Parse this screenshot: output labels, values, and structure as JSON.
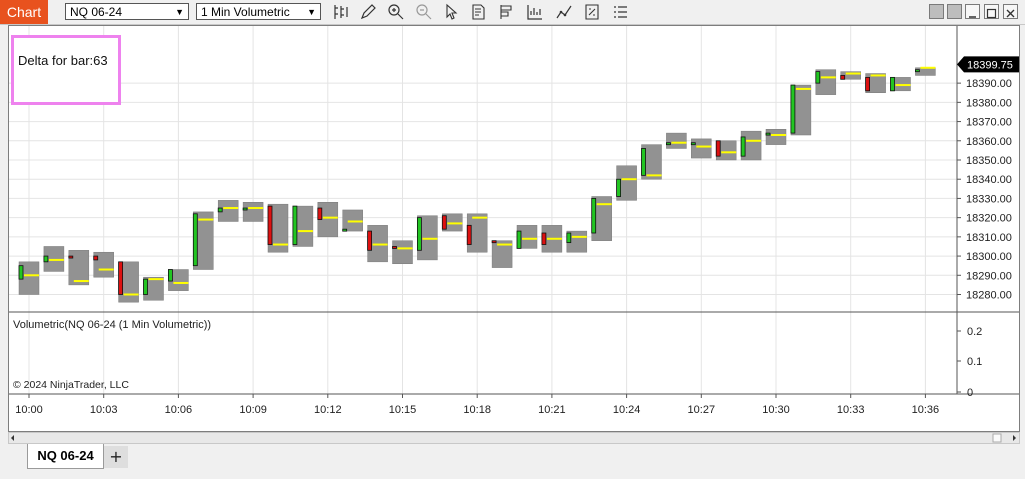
{
  "app": {
    "title": "Chart"
  },
  "toolbar": {
    "instrument": "NQ 06-24",
    "interval": "1 Min Volumetric",
    "icons": [
      "bars-type-icon",
      "draw-pencil-icon",
      "zoom-in-icon",
      "zoom-out-icon",
      "pointer-icon",
      "properties-icon",
      "templates-icon",
      "chart-trader-icon",
      "indicators-icon",
      "strategies-icon",
      "data-box-icon"
    ]
  },
  "window_buttons": [
    "tile-button",
    "grid-button",
    "minimize-button",
    "maximize-button",
    "close-button"
  ],
  "chart": {
    "delta_label": "Delta for bar:63",
    "last_price": "18399.75",
    "price_ticks": [
      "18390.00",
      "18380.00",
      "18370.00",
      "18360.00",
      "18350.00",
      "18340.00",
      "18330.00",
      "18320.00",
      "18310.00",
      "18300.00",
      "18290.00",
      "18280.00"
    ],
    "indicator_title": "Volumetric(NQ 06-24 (1 Min Volumetric))",
    "indicator_ticks": [
      "0.2",
      "0.1",
      "0"
    ],
    "copyright": "© 2024 NinjaTrader, LLC",
    "time_ticks": [
      "10:00",
      "10:03",
      "10:06",
      "10:09",
      "10:12",
      "10:15",
      "10:18",
      "10:21",
      "10:24",
      "10:27",
      "10:30",
      "10:33",
      "10:36"
    ]
  },
  "tabs": {
    "active": "NQ 06-24",
    "add": "+"
  },
  "chart_data": {
    "type": "candlestick",
    "bars": [
      {
        "t": "10:00",
        "o": 18288,
        "h": 18297,
        "l": 18280,
        "c": 18295,
        "poc": 18290
      },
      {
        "t": "10:01",
        "o": 18297,
        "h": 18305,
        "l": 18292,
        "c": 18300,
        "poc": 18298
      },
      {
        "t": "10:02",
        "o": 18300,
        "h": 18303,
        "l": 18285,
        "c": 18299,
        "poc": 18287
      },
      {
        "t": "10:03",
        "o": 18300,
        "h": 18302,
        "l": 18289,
        "c": 18298,
        "poc": 18293
      },
      {
        "t": "10:04",
        "o": 18297,
        "h": 18297,
        "l": 18276,
        "c": 18280,
        "poc": 18280
      },
      {
        "t": "10:05",
        "o": 18280,
        "h": 18289,
        "l": 18277,
        "c": 18288,
        "poc": 18288
      },
      {
        "t": "10:06",
        "o": 18287,
        "h": 18293,
        "l": 18282,
        "c": 18293,
        "poc": 18286
      },
      {
        "t": "10:07",
        "o": 18295,
        "h": 18323,
        "l": 18293,
        "c": 18322,
        "poc": 18319
      },
      {
        "t": "10:08",
        "o": 18323,
        "h": 18329,
        "l": 18318,
        "c": 18325,
        "poc": 18325
      },
      {
        "t": "10:09",
        "o": 18325,
        "h": 18328,
        "l": 18318,
        "c": 18325,
        "poc": 18325
      },
      {
        "t": "10:10",
        "o": 18326,
        "h": 18327,
        "l": 18302,
        "c": 18306,
        "poc": 18306
      },
      {
        "t": "10:11",
        "o": 18306,
        "h": 18326,
        "l": 18305,
        "c": 18326,
        "poc": 18313
      },
      {
        "t": "10:12",
        "o": 18325,
        "h": 18328,
        "l": 18310,
        "c": 18319,
        "poc": 18320
      },
      {
        "t": "10:13",
        "o": 18314,
        "h": 18324,
        "l": 18313,
        "c": 18314,
        "poc": 18318
      },
      {
        "t": "10:14",
        "o": 18313,
        "h": 18316,
        "l": 18297,
        "c": 18303,
        "poc": 18306
      },
      {
        "t": "10:15",
        "o": 18305,
        "h": 18308,
        "l": 18296,
        "c": 18304,
        "poc": 18304
      },
      {
        "t": "10:16",
        "o": 18303,
        "h": 18321,
        "l": 18298,
        "c": 18320,
        "poc": 18309
      },
      {
        "t": "10:17",
        "o": 18321,
        "h": 18322,
        "l": 18313,
        "c": 18314,
        "poc": 18317
      },
      {
        "t": "10:18",
        "o": 18316,
        "h": 18322,
        "l": 18302,
        "c": 18306,
        "poc": 18320
      },
      {
        "t": "10:19",
        "o": 18308,
        "h": 18308,
        "l": 18294,
        "c": 18307,
        "poc": 18306
      },
      {
        "t": "10:20",
        "o": 18304,
        "h": 18316,
        "l": 18304,
        "c": 18313,
        "poc": 18309
      },
      {
        "t": "10:21",
        "o": 18312,
        "h": 18316,
        "l": 18302,
        "c": 18306,
        "poc": 18309
      },
      {
        "t": "10:22",
        "o": 18307,
        "h": 18313,
        "l": 18302,
        "c": 18312,
        "poc": 18310
      },
      {
        "t": "10:23",
        "o": 18312,
        "h": 18331,
        "l": 18308,
        "c": 18330,
        "poc": 18327
      },
      {
        "t": "10:24",
        "o": 18331,
        "h": 18347,
        "l": 18329,
        "c": 18340,
        "poc": 18340
      },
      {
        "t": "10:25",
        "o": 18342,
        "h": 18358,
        "l": 18340,
        "c": 18356,
        "poc": 18342
      },
      {
        "t": "10:26",
        "o": 18359,
        "h": 18364,
        "l": 18356,
        "c": 18359,
        "poc": 18359
      },
      {
        "t": "10:27",
        "o": 18358,
        "h": 18361,
        "l": 18351,
        "c": 18359,
        "poc": 18357
      },
      {
        "t": "10:28",
        "o": 18360,
        "h": 18360,
        "l": 18350,
        "c": 18352,
        "poc": 18354
      },
      {
        "t": "10:29",
        "o": 18352,
        "h": 18365,
        "l": 18350,
        "c": 18362,
        "poc": 18360
      },
      {
        "t": "10:30",
        "o": 18363,
        "h": 18366,
        "l": 18358,
        "c": 18364,
        "poc": 18363
      },
      {
        "t": "10:31",
        "o": 18364,
        "h": 18389,
        "l": 18363,
        "c": 18389,
        "poc": 18387
      },
      {
        "t": "10:32",
        "o": 18390,
        "h": 18397,
        "l": 18384,
        "c": 18396,
        "poc": 18393
      },
      {
        "t": "10:33",
        "o": 18394,
        "h": 18396,
        "l": 18392,
        "c": 18392,
        "poc": 18395
      },
      {
        "t": "10:34",
        "o": 18393,
        "h": 18395,
        "l": 18385,
        "c": 18386,
        "poc": 18394
      },
      {
        "t": "10:35",
        "o": 18386,
        "h": 18393,
        "l": 18386,
        "c": 18393,
        "poc": 18389
      },
      {
        "t": "10:36",
        "o": 18396,
        "h": 18398,
        "l": 18394,
        "c": 18397,
        "poc": 18398
      }
    ]
  }
}
